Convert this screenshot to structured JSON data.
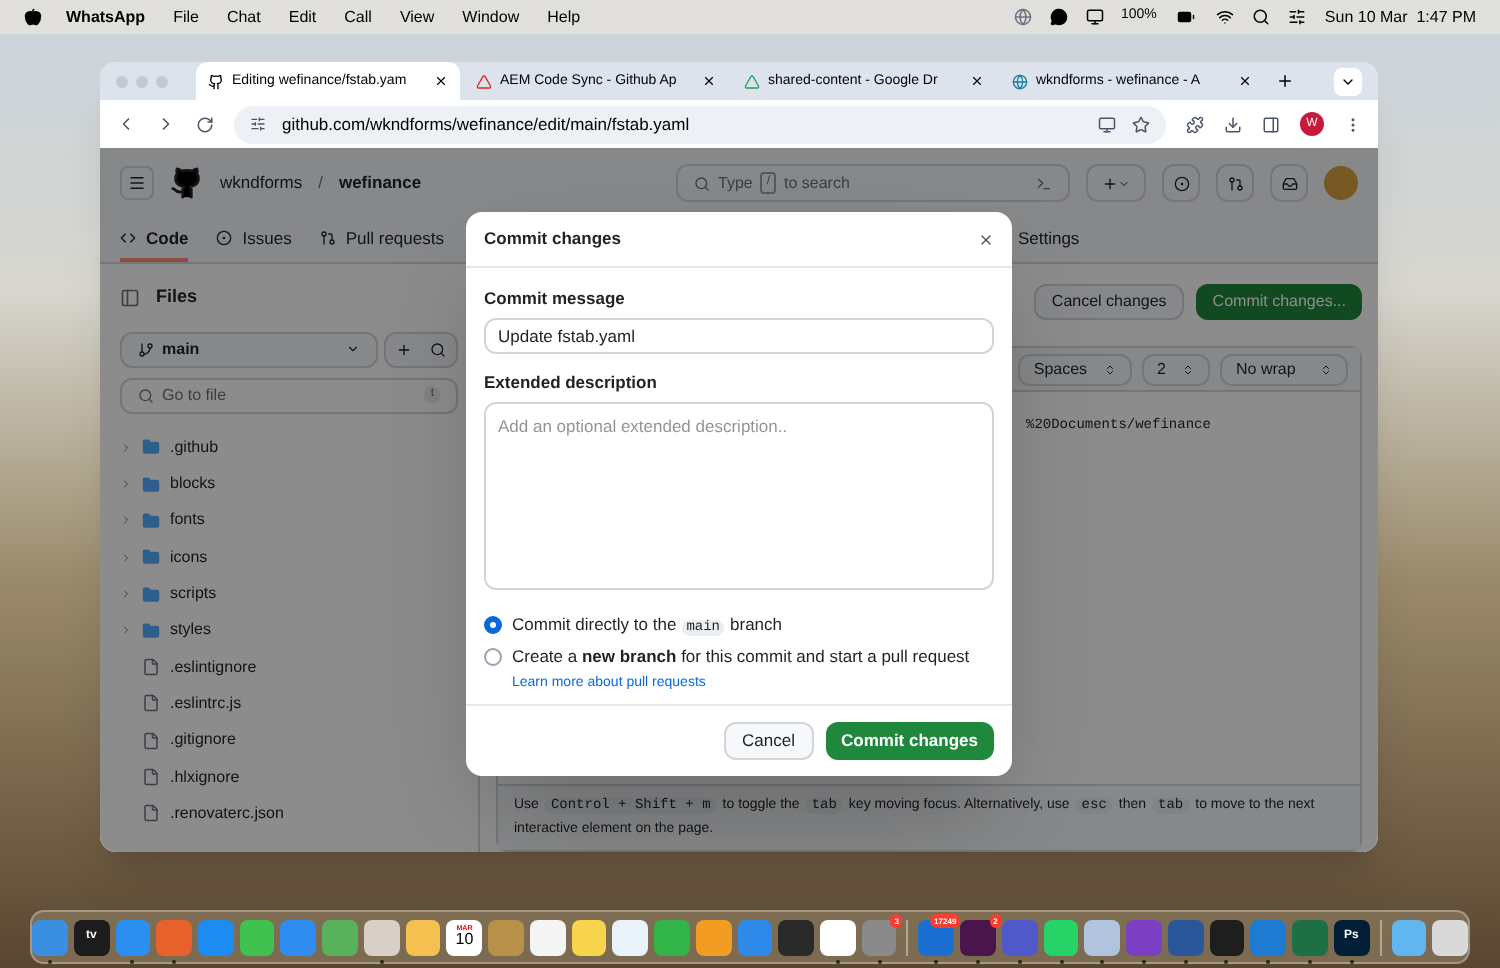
{
  "menubar": {
    "app": "WhatsApp",
    "menus": [
      "File",
      "Chat",
      "Edit",
      "Call",
      "View",
      "Window",
      "Help"
    ],
    "battery": "100%",
    "clock": "Sun 10 Mar  1:47 PM"
  },
  "browser": {
    "tabs": [
      {
        "label": "Editing wefinance/fstab.yam",
        "selected": true,
        "kind": "github"
      },
      {
        "label": "AEM Code Sync - Github Ap",
        "selected": false,
        "kind": "adobe"
      },
      {
        "label": "shared-content - Google Dr",
        "selected": false,
        "kind": "drive"
      },
      {
        "label": "wkndforms - wefinance - A",
        "selected": false,
        "kind": "aem"
      }
    ],
    "url": "github.com/wkndforms/wefinance/edit/main/fstab.yaml",
    "profile": "W"
  },
  "repo": {
    "owner": "wkndforms",
    "separator": "/",
    "name": "wefinance",
    "search": {
      "placeholder_parts": [
        "Type",
        "/",
        "to search"
      ]
    },
    "nav": [
      {
        "label": "Code",
        "selected": true,
        "kind": "code"
      },
      {
        "label": "Issues",
        "selected": false,
        "kind": "issues"
      },
      {
        "label": "Pull requests",
        "selected": false,
        "kind": "pulls"
      },
      {
        "label": "Settings",
        "selected": false,
        "kind": "settings"
      }
    ]
  },
  "sidebar": {
    "title": "Files",
    "branch": "main",
    "goto": {
      "placeholder": "Go to file",
      "key": "t"
    },
    "tree": [
      {
        "name": ".github",
        "kind": "folder"
      },
      {
        "name": "blocks",
        "kind": "folder"
      },
      {
        "name": "fonts",
        "kind": "folder"
      },
      {
        "name": "icons",
        "kind": "folder"
      },
      {
        "name": "scripts",
        "kind": "folder"
      },
      {
        "name": "styles",
        "kind": "folder"
      },
      {
        "name": ".eslintignore",
        "kind": "file"
      },
      {
        "name": ".eslintrc.js",
        "kind": "file"
      },
      {
        "name": ".gitignore",
        "kind": "file"
      },
      {
        "name": ".hlxignore",
        "kind": "file"
      },
      {
        "name": ".renovaterc.json",
        "kind": "file"
      }
    ]
  },
  "editor": {
    "cancel": "Cancel changes",
    "commit": "Commit changes...",
    "selects": [
      "Spaces",
      "2",
      "No wrap"
    ],
    "code_line": "%20Documents/wefinance",
    "footer": [
      {
        "text": "Use",
        "kind": "text"
      },
      {
        "text": "Control + Shift + m",
        "kind": "key"
      },
      {
        "text": "to toggle the",
        "kind": "text"
      },
      {
        "text": "tab",
        "kind": "key"
      },
      {
        "text": "key moving focus. Alternatively, use",
        "kind": "text"
      },
      {
        "text": "esc",
        "kind": "key"
      },
      {
        "text": "then",
        "kind": "text"
      },
      {
        "text": "tab",
        "kind": "key"
      },
      {
        "text": "to move to the next interactive element on the page.",
        "kind": "text"
      }
    ]
  },
  "dialog": {
    "title": "Commit changes",
    "message_label": "Commit message",
    "message": "Update fstab.yaml",
    "description_label": "Extended description",
    "description": {
      "placeholder": "Add an optional extended description.."
    },
    "options": [
      {
        "parts": [
          {
            "text": "Commit directly to the",
            "kind": "text"
          },
          {
            "text": "main",
            "kind": "code"
          },
          {
            "text": "branch",
            "kind": "text"
          }
        ],
        "selected": true
      },
      {
        "parts": [
          {
            "text": "Create a **new branch** for this commit and start a pull request",
            "kind": "text"
          }
        ],
        "selected": false
      }
    ],
    "link": "Learn more about pull requests",
    "cancel": "Cancel",
    "submit": "Commit changes"
  },
  "dock": [
    {
      "color": "#3b8fe0",
      "running": true
    },
    {
      "color": "#1c1c1e",
      "running": false,
      "text": "tv"
    },
    {
      "color": "#2a8ff0",
      "running": true
    },
    {
      "color": "#e8602a",
      "running": true
    },
    {
      "color": "#1d8cf0",
      "running": false
    },
    {
      "color": "#3fc24e",
      "running": false
    },
    {
      "color": "#2f8df2",
      "running": false
    },
    {
      "color": "#58b25c",
      "running": false
    },
    {
      "color": "#d8cfc6",
      "running": true
    },
    {
      "color": "#f4c04f",
      "running": false
    },
    {
      "color": "#ffffff",
      "running": false,
      "month": "MAR",
      "day": "10"
    },
    {
      "color": "#b8904a",
      "running": false
    },
    {
      "color": "#f4f4f4",
      "running": false
    },
    {
      "color": "#f8d44c",
      "running": false
    },
    {
      "color": "#e9f1fb",
      "running": false
    },
    {
      "color": "#32b548",
      "running": false
    },
    {
      "color": "#f29c24",
      "running": false
    },
    {
      "color": "#2f89e8",
      "running": false
    },
    {
      "color": "#2a2a2a",
      "running": false
    },
    {
      "color": "#ffffff",
      "running": true
    },
    {
      "color": "#8a8a8a",
      "running": true,
      "badge": "3"
    },
    {
      "color": "#1a6fd0",
      "running": true,
      "badge": "17249",
      "sep": true
    },
    {
      "color": "#4a154b",
      "running": true,
      "badge": "2"
    },
    {
      "color": "#5059c9",
      "running": true
    },
    {
      "color": "#25d366",
      "running": true
    },
    {
      "color": "#b0c4de",
      "running": true
    },
    {
      "color": "#7b3fc4",
      "running": true
    },
    {
      "color": "#2b579a",
      "running": true
    },
    {
      "color": "#1e1e1e",
      "running": true
    },
    {
      "color": "#1f7ad1",
      "running": true
    },
    {
      "color": "#1d7044",
      "running": true
    },
    {
      "color": "#001e36",
      "running": true,
      "text": "Ps"
    },
    {
      "color": "#62b6f0",
      "running": false,
      "sep": true
    },
    {
      "color": "#d9d9d9",
      "running": false
    }
  ]
}
